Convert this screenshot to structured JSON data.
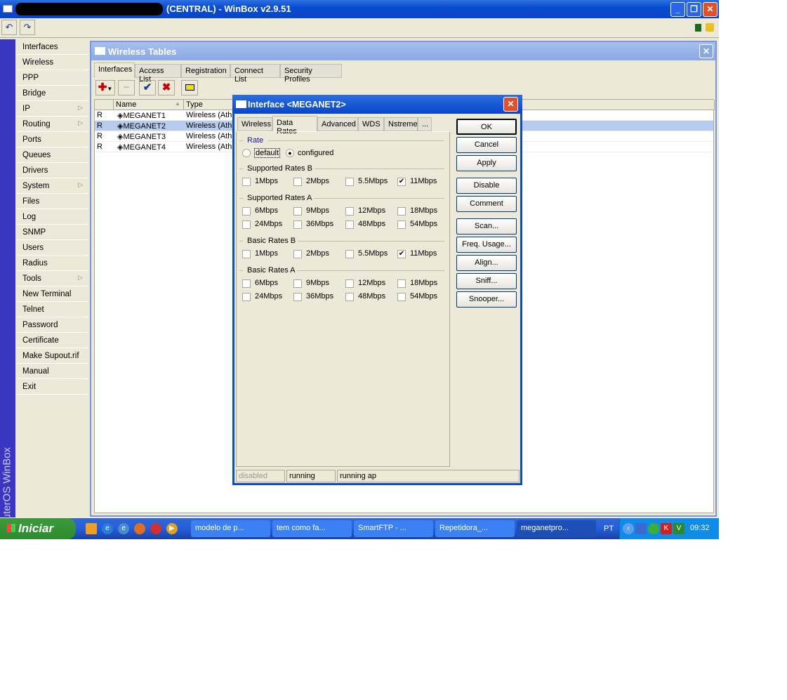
{
  "window": {
    "title": "(CENTRAL) - WinBox v2.9.51",
    "brand": "RouterOS WinBox"
  },
  "toolbar": {
    "undo": "↶",
    "redo": "↷"
  },
  "sidebar": {
    "items": [
      {
        "label": "Interfaces"
      },
      {
        "label": "Wireless"
      },
      {
        "label": "PPP"
      },
      {
        "label": "Bridge"
      },
      {
        "label": "IP",
        "submenu": true
      },
      {
        "label": "Routing",
        "submenu": true
      },
      {
        "label": "Ports"
      },
      {
        "label": "Queues"
      },
      {
        "label": "Drivers"
      },
      {
        "label": "System",
        "submenu": true
      },
      {
        "label": "Files"
      },
      {
        "label": "Log"
      },
      {
        "label": "SNMP"
      },
      {
        "label": "Users"
      },
      {
        "label": "Radius"
      },
      {
        "label": "Tools",
        "submenu": true
      },
      {
        "label": "New Terminal"
      },
      {
        "label": "Telnet"
      },
      {
        "label": "Password"
      },
      {
        "label": "Certificate"
      },
      {
        "label": "Make Supout.rif"
      },
      {
        "label": "Manual"
      },
      {
        "label": "Exit"
      }
    ]
  },
  "wireless_tables": {
    "title": "Wireless Tables",
    "tabs": [
      "Interfaces",
      "Access List",
      "Registration",
      "Connect List",
      "Security Profiles"
    ],
    "columns": [
      "Name",
      "Type"
    ],
    "rows": [
      {
        "flag": "R",
        "name": "◈MEGANET1",
        "type": "Wireless (Athe"
      },
      {
        "flag": "R",
        "name": "◈MEGANET2",
        "type": "Wireless (Athe",
        "selected": true
      },
      {
        "flag": "R",
        "name": "◈MEGANET3",
        "type": "Wireless (Athe"
      },
      {
        "flag": "R",
        "name": "◈MEGANET4",
        "type": "Wireless (Athe"
      }
    ]
  },
  "dialog": {
    "title": "Interface <MEGANET2>",
    "tabs": [
      "Wireless",
      "Data Rates",
      "Advanced",
      "WDS",
      "Nstreme",
      "..."
    ],
    "rate": {
      "legend": "Rate",
      "default": "default",
      "configured": "configured",
      "selected": "configured"
    },
    "groups": [
      {
        "legend": "Supported Rates B",
        "options": [
          {
            "label": "1Mbps",
            "checked": false
          },
          {
            "label": "2Mbps",
            "checked": false
          },
          {
            "label": "5.5Mbps",
            "checked": false
          },
          {
            "label": "11Mbps",
            "checked": true
          }
        ]
      },
      {
        "legend": "Supported Rates A",
        "options": [
          {
            "label": "6Mbps",
            "checked": false
          },
          {
            "label": "9Mbps",
            "checked": false
          },
          {
            "label": "12Mbps",
            "checked": false
          },
          {
            "label": "18Mbps",
            "checked": false
          },
          {
            "label": "24Mbps",
            "checked": false
          },
          {
            "label": "36Mbps",
            "checked": false
          },
          {
            "label": "48Mbps",
            "checked": false
          },
          {
            "label": "54Mbps",
            "checked": false
          }
        ]
      },
      {
        "legend": "Basic Rates B",
        "options": [
          {
            "label": "1Mbps",
            "checked": false
          },
          {
            "label": "2Mbps",
            "checked": false
          },
          {
            "label": "5.5Mbps",
            "checked": false
          },
          {
            "label": "11Mbps",
            "checked": true
          }
        ]
      },
      {
        "legend": "Basic Rates A",
        "options": [
          {
            "label": "6Mbps",
            "checked": false
          },
          {
            "label": "9Mbps",
            "checked": false
          },
          {
            "label": "12Mbps",
            "checked": false
          },
          {
            "label": "18Mbps",
            "checked": false
          },
          {
            "label": "24Mbps",
            "checked": false
          },
          {
            "label": "36Mbps",
            "checked": false
          },
          {
            "label": "48Mbps",
            "checked": false
          },
          {
            "label": "54Mbps",
            "checked": false
          }
        ]
      }
    ],
    "buttons": [
      "OK",
      "Cancel",
      "Apply",
      "Disable",
      "Comment",
      "Scan...",
      "Freq. Usage...",
      "Align...",
      "Sniff...",
      "Snooper..."
    ],
    "status": [
      "disabled",
      "running",
      "running ap"
    ]
  },
  "taskbar": {
    "start": "Iniciar",
    "tasks": [
      "modelo de p...",
      "tem como fa...",
      "SmartFTP - ...",
      "Repetidora_...",
      "meganetpro..."
    ],
    "lang": "PT",
    "clock": "09:32"
  }
}
